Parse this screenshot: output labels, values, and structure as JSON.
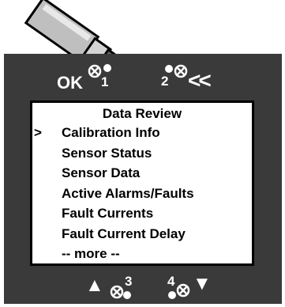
{
  "buttons": {
    "ok": {
      "label": "OK",
      "number": "1"
    },
    "back": {
      "number": "2",
      "symbol": "<<"
    },
    "up": {
      "symbol": "▲",
      "number": "3"
    },
    "down": {
      "number": "4",
      "symbol": "▼"
    }
  },
  "screen": {
    "title": "Data Review",
    "cursor": ">",
    "items": [
      {
        "label": "Calibration Info",
        "selected": true
      },
      {
        "label": "Sensor Status",
        "selected": false
      },
      {
        "label": "Sensor Data",
        "selected": false
      },
      {
        "label": "Active Alarms/Faults",
        "selected": false
      },
      {
        "label": "Fault Currents",
        "selected": false
      },
      {
        "label": "Fault Current Delay",
        "selected": false
      },
      {
        "label": "-- more --",
        "selected": false
      }
    ]
  },
  "icons": {
    "magnet_tool": "magnet-wand-icon",
    "magnetic_switch": "magnetic-switch-icon"
  },
  "colors": {
    "panel": "#3a3a3a",
    "screen_bg": "#ffffff",
    "text": "#000000",
    "label": "#ffffff"
  }
}
